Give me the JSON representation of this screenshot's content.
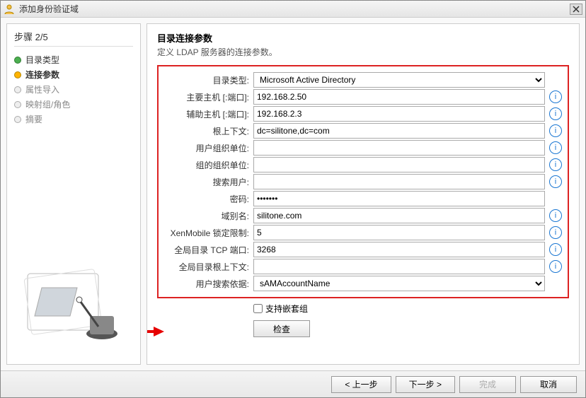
{
  "titlebar": {
    "title": "添加身份验证域"
  },
  "sidebar": {
    "step_label": "步骤 2/5",
    "items": [
      {
        "label": "目录类型"
      },
      {
        "label": "连接参数"
      },
      {
        "label": "属性导入"
      },
      {
        "label": "映射组/角色"
      },
      {
        "label": "摘要"
      }
    ]
  },
  "main": {
    "title": "目录连接参数",
    "subtitle": "定义 LDAP 服务器的连接参数。",
    "fields": {
      "dir_type_label": "目录类型:",
      "dir_type_value": "Microsoft Active Directory",
      "primary_host_label": "主要主机 [:端口]:",
      "primary_host_value": "192.168.2.50",
      "secondary_host_label": "辅助主机 [:端口]:",
      "secondary_host_value": "192.168.2.3",
      "root_ctx_label": "根上下文:",
      "root_ctx_value": "dc=silitone,dc=com",
      "user_ou_label": "用户组织单位:",
      "user_ou_value": "",
      "group_ou_label": "组的组织单位:",
      "group_ou_value": "",
      "search_user_label": "搜索用户:",
      "search_user_value": "",
      "password_label": "密码:",
      "password_value": "●●●●●●●",
      "domain_alias_label": "域别名:",
      "domain_alias_value": "silitone.com",
      "lock_limit_label": "XenMobile 锁定限制:",
      "lock_limit_value": "5",
      "gc_port_label": "全局目录 TCP 端口:",
      "gc_port_value": "3268",
      "gc_root_label": "全局目录根上下文:",
      "gc_root_value": "",
      "user_search_by_label": "用户搜索依据:",
      "user_search_by_value": "sAMAccountName"
    },
    "nested_groups_label": "支持嵌套组",
    "check_button": "检查"
  },
  "footer": {
    "back": "< 上一步",
    "next": "下一步 >",
    "finish": "完成",
    "cancel": "取消"
  }
}
